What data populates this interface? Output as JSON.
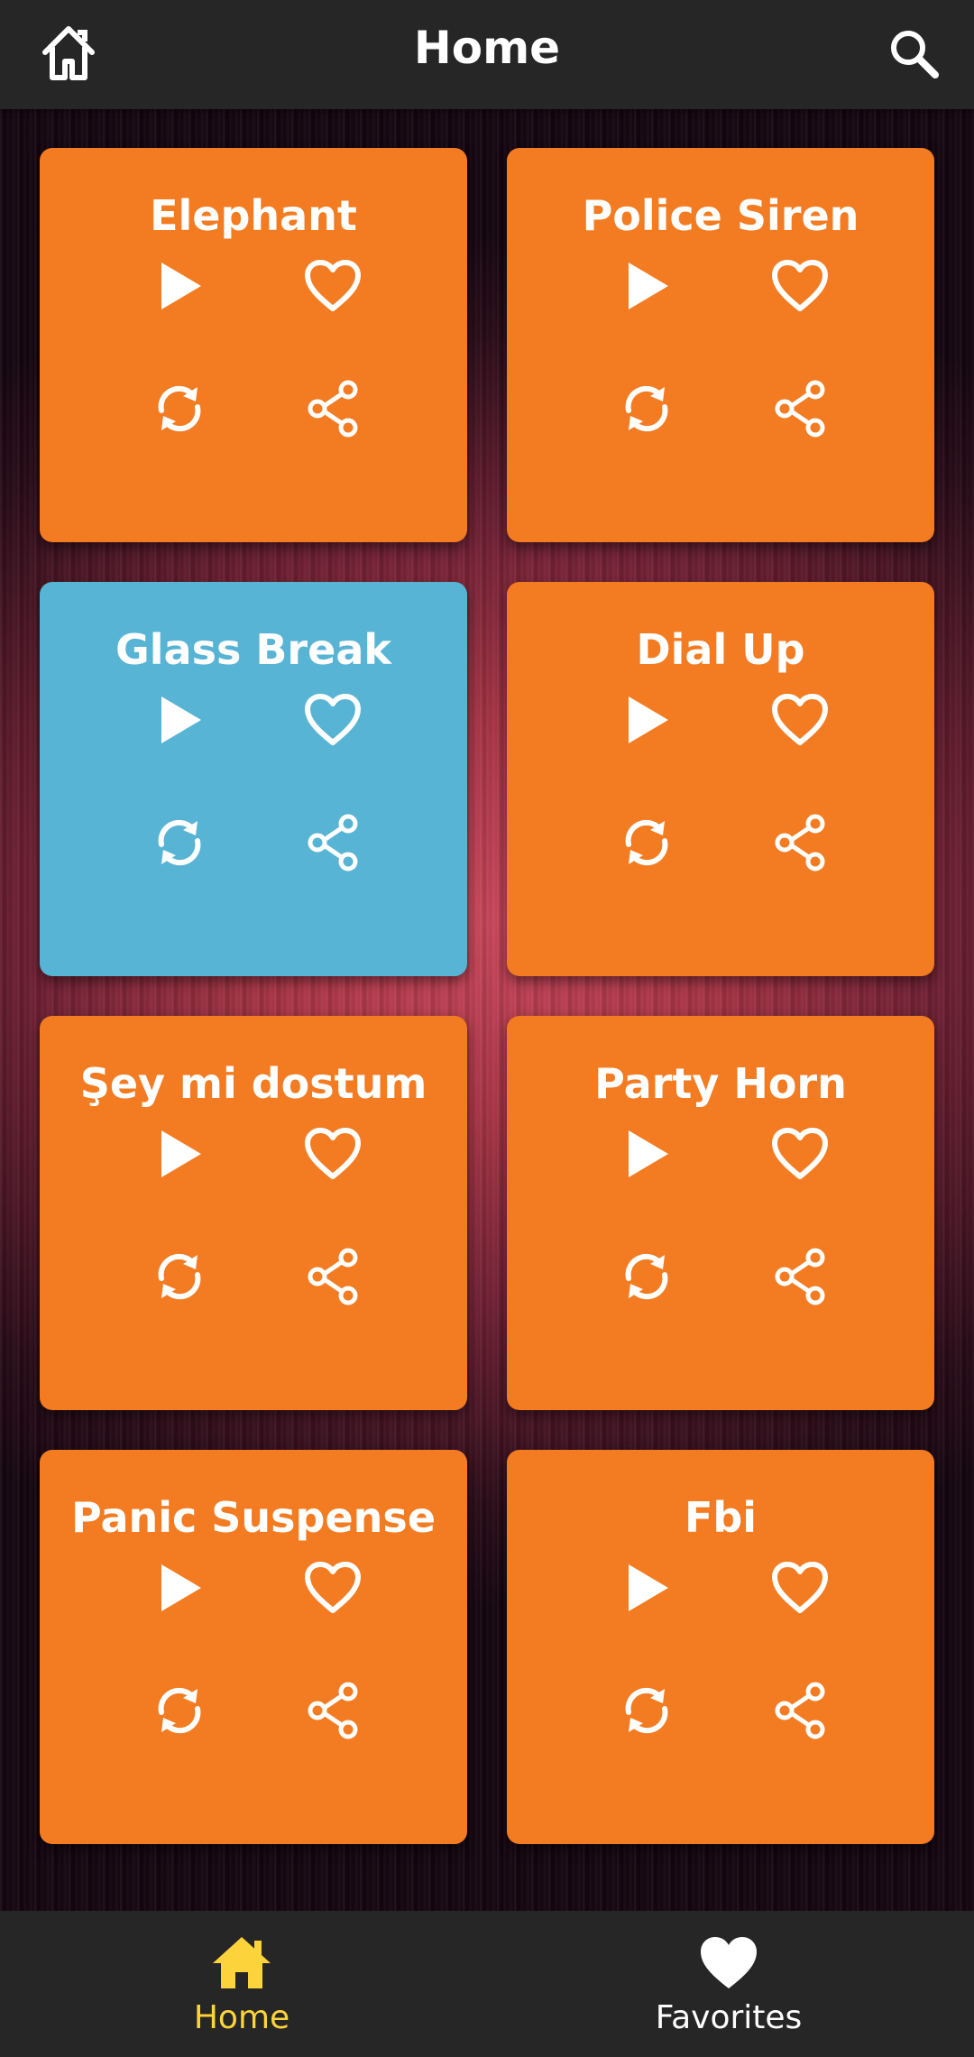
{
  "header": {
    "title": "Home",
    "home_icon": "home-icon",
    "search_icon": "search-icon"
  },
  "colors": {
    "orange": "#f37b21",
    "blue": "#57b4d4",
    "bar": "#262626",
    "active_tab": "#fdd33b",
    "white": "#ffffff"
  },
  "sounds": [
    {
      "name": "Elephant",
      "color": "#f37b21"
    },
    {
      "name": "Police Siren",
      "color": "#f37b21"
    },
    {
      "name": "Glass Break",
      "color": "#57b4d4"
    },
    {
      "name": "Dial Up",
      "color": "#f37b21"
    },
    {
      "name": "Şey mi dostum",
      "color": "#f37b21"
    },
    {
      "name": "Party Horn",
      "color": "#f37b21"
    },
    {
      "name": "Panic Suspense",
      "color": "#f37b21"
    },
    {
      "name": "Fbi",
      "color": "#f37b21"
    }
  ],
  "card_actions": [
    "play-icon",
    "heart-icon",
    "loop-icon",
    "share-icon"
  ],
  "bottom_nav": {
    "items": [
      {
        "label": "Home",
        "icon": "home-filled-icon",
        "active": true
      },
      {
        "label": "Favorites",
        "icon": "heart-filled-icon",
        "active": false
      }
    ]
  }
}
